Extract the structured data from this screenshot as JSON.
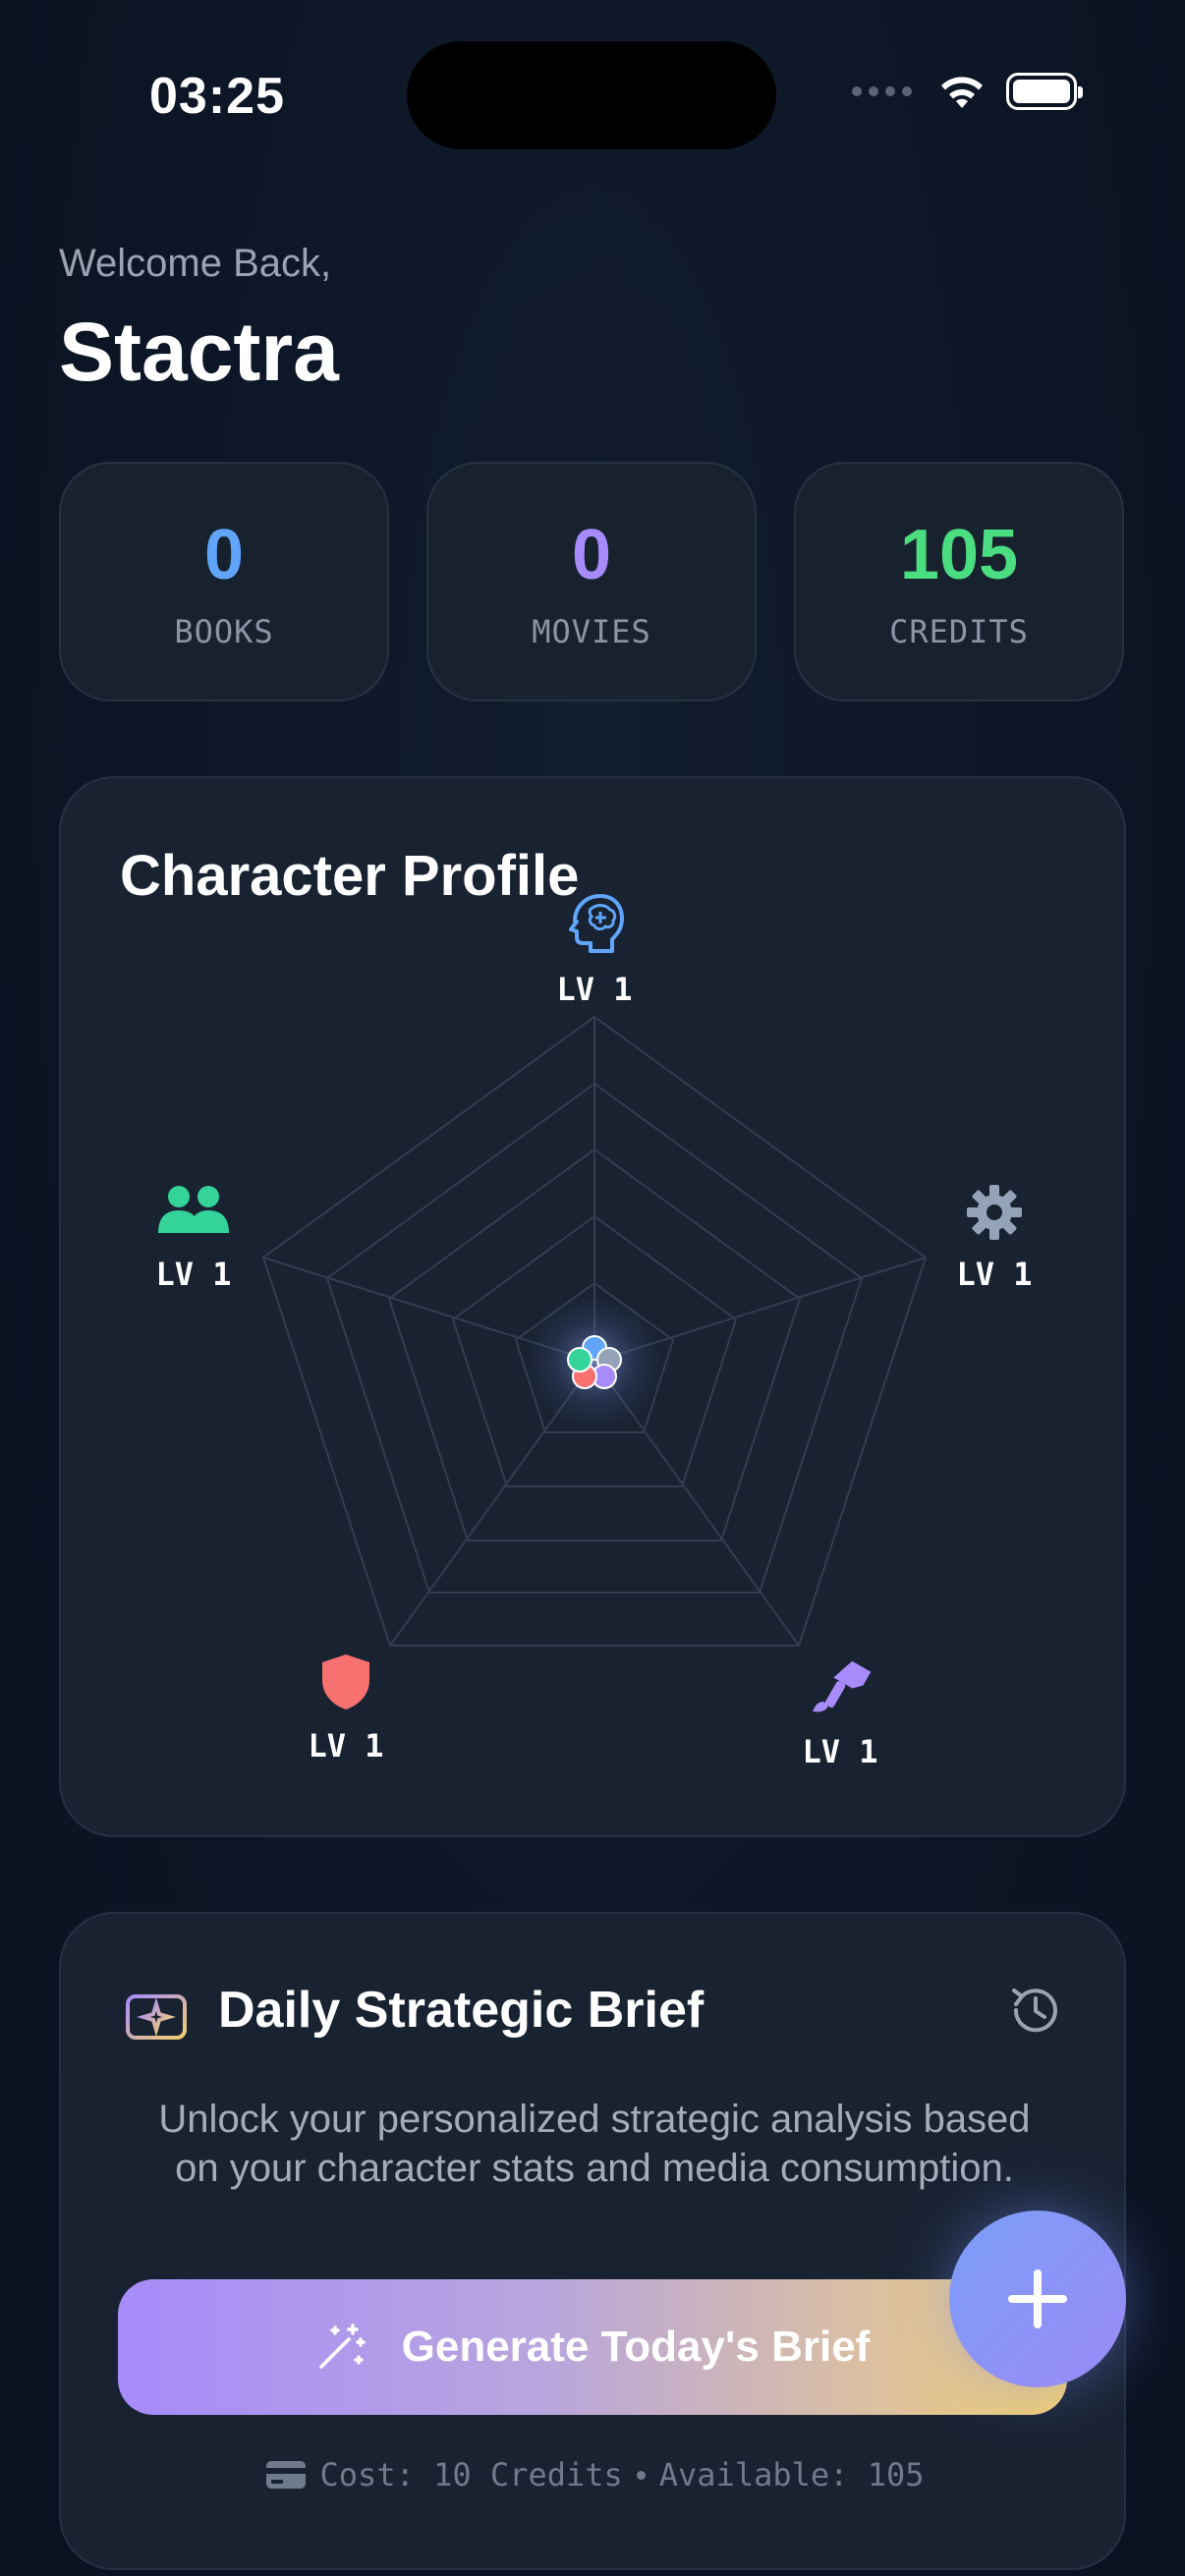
{
  "status_bar": {
    "time": "03:25"
  },
  "header": {
    "welcome": "Welcome Back,",
    "username": "Stactra"
  },
  "stats": [
    {
      "value": "0",
      "label": "BOOKS",
      "color": "#60a5fa"
    },
    {
      "value": "0",
      "label": "MOVIES",
      "color": "#a78bfa"
    },
    {
      "value": "105",
      "label": "CREDITS",
      "color": "#4ade80"
    }
  ],
  "character_profile": {
    "title": "Character Profile",
    "attributes": [
      {
        "icon": "brain-head-icon",
        "color": "#60a5fa",
        "level": "LV 1"
      },
      {
        "icon": "gear-icon",
        "color": "#94a3b8",
        "level": "LV 1"
      },
      {
        "icon": "paintbrush-icon",
        "color": "#a78bfa",
        "level": "LV 1"
      },
      {
        "icon": "shield-icon",
        "color": "#f87171",
        "level": "LV 1"
      },
      {
        "icon": "users-icon",
        "color": "#34d399",
        "level": "LV 1"
      }
    ]
  },
  "daily_brief": {
    "icon": "sparkle-stack-icon",
    "title": "Daily Strategic Brief",
    "history_icon": "history-icon",
    "description": "Unlock your personalized strategic analysis based on your character stats and media consumption.",
    "button_label": "Generate Today's Brief",
    "button_icon": "magic-wand-icon",
    "cost_icon": "credit-card-icon",
    "cost_text": "Cost: 10 Credits",
    "available_text": "Available: 105"
  },
  "fab": {
    "icon": "plus-icon"
  }
}
